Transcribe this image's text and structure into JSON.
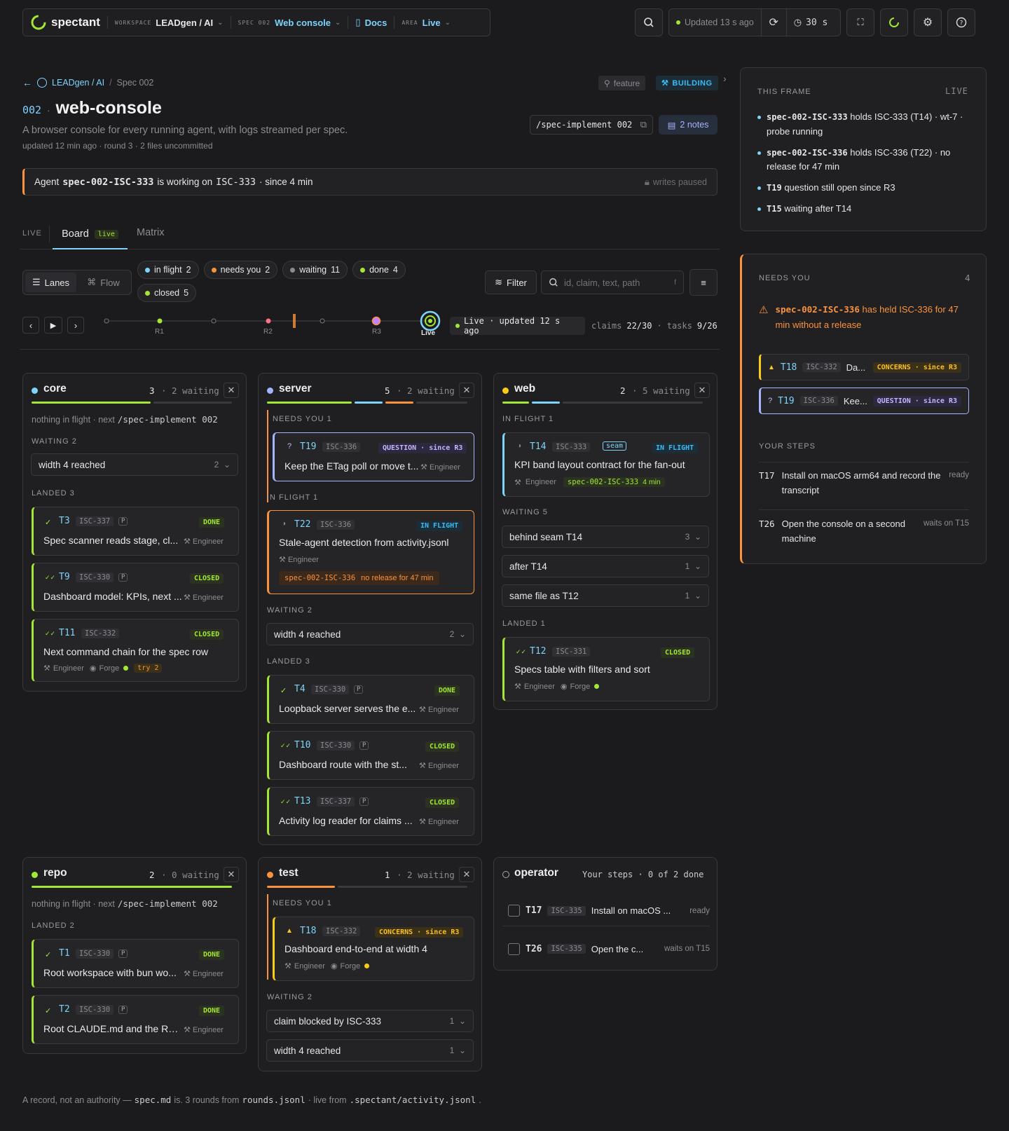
{
  "brand": {
    "name": "spectant"
  },
  "topbar": {
    "workspace_label": "WORKSPACE",
    "workspace": "LEADgen / AI",
    "spec_label": "SPEC 002",
    "spec": "Web console",
    "docs": "Docs",
    "area_label": "AREA",
    "area": "Live"
  },
  "status": {
    "updated": "Updated 13 s ago",
    "interval": "30 s"
  },
  "breadcrumb": {
    "org": "LEADgen / AI",
    "sep": "/",
    "spec": "Spec 002"
  },
  "header": {
    "num": "002",
    "dot": "·",
    "title": "web-console",
    "desc": "A browser console for every running agent, with logs streamed per spec.",
    "meta": "updated 12 min ago · round 3 · 2 files uncommitted",
    "feature": "feature",
    "building": "BUILDING",
    "command": "/spec-implement 002",
    "notes": "2 notes"
  },
  "banner": {
    "pre": "Agent",
    "agent": "spec-002-ISC-333",
    "mid": "is working on",
    "task": "ISC-333",
    "post": "· since 4 min",
    "writes": "writes paused"
  },
  "tabs": {
    "live_label": "LIVE",
    "board": "Board",
    "board_badge": "live",
    "matrix": "Matrix"
  },
  "controls": {
    "lanes": "Lanes",
    "flow": "Flow",
    "filter": "Filter",
    "search_placeholder": "id, claim, text, path",
    "search_key": "f"
  },
  "filters": [
    {
      "label": "in flight",
      "count": "2",
      "color": "#7dd3fc"
    },
    {
      "label": "needs you",
      "count": "2",
      "color": "#fb923c"
    },
    {
      "label": "waiting",
      "count": "11",
      "color": "#8c8c90"
    },
    {
      "label": "done",
      "count": "4",
      "color": "#a3e635"
    },
    {
      "label": "closed",
      "count": "5",
      "color": "#a3e635"
    }
  ],
  "timeline": {
    "r1": "R1",
    "r2": "R2",
    "r3": "R3",
    "live": "Live",
    "live_status": "Live · updated 12 s ago",
    "claims_label": "claims",
    "claims": "22/30",
    "tasks_label": "tasks",
    "tasks": "9/26",
    "sep": "·"
  },
  "cols": {
    "core": {
      "name": "core",
      "count": "3",
      "waiting": "· 2 waiting",
      "idle": "nothing in flight · next",
      "next": "/spec-implement 002",
      "waiting_sect": "WAITING 2",
      "landed_sect": "LANDED 3",
      "waiting_items": [
        {
          "label": "width 4 reached",
          "n": "2"
        }
      ],
      "tasks": [
        {
          "id": "T3",
          "isc": "ISC-337",
          "p": "P",
          "status": "DONE",
          "title": "Spec scanner reads stage, cl...",
          "role": "Engineer",
          "mark": "✓"
        },
        {
          "id": "T9",
          "isc": "ISC-330",
          "p": "P",
          "status": "CLOSED",
          "title": "Dashboard model: KPIs, next ...",
          "role": "Engineer",
          "mark": "✓✓"
        },
        {
          "id": "T11",
          "isc": "ISC-332",
          "status": "CLOSED",
          "title": "Next command chain for the spec row",
          "role": "Engineer",
          "forge": "Forge",
          "try": "try 2",
          "mark": "✓✓"
        }
      ]
    },
    "server": {
      "name": "server",
      "count": "5",
      "waiting": "· 2 waiting",
      "needs_sect": "NEEDS YOU 1",
      "inflight_sect": "IN FLIGHT 1",
      "waiting_sect": "WAITING 2",
      "landed_sect": "LANDED 3",
      "needs": {
        "id": "T19",
        "isc": "ISC-336",
        "status": "QUESTION · since R3",
        "title": "Keep the ETag poll or move t...",
        "role": "Engineer",
        "mark": "?"
      },
      "inflight": {
        "id": "T22",
        "isc": "ISC-336",
        "status": "IN FLIGHT",
        "title": "Stale-agent detection from activity.jsonl",
        "role": "Engineer",
        "agent": "spec-002-ISC-336",
        "warn": "no release for 47 min"
      },
      "waiting_items": [
        {
          "label": "width 4 reached",
          "n": "2"
        }
      ],
      "tasks": [
        {
          "id": "T4",
          "isc": "ISC-330",
          "p": "P",
          "status": "DONE",
          "title": "Loopback server serves the e...",
          "role": "Engineer",
          "mark": "✓"
        },
        {
          "id": "T10",
          "isc": "ISC-330",
          "p": "P",
          "status": "CLOSED",
          "title": "Dashboard route with the st...",
          "role": "Engineer",
          "mark": "✓✓"
        },
        {
          "id": "T13",
          "isc": "ISC-337",
          "p": "P",
          "status": "CLOSED",
          "title": "Activity log reader for claims ...",
          "role": "Engineer",
          "mark": "✓✓"
        }
      ]
    },
    "web": {
      "name": "web",
      "count": "2",
      "waiting": "· 5 waiting",
      "inflight_sect": "IN FLIGHT 1",
      "waiting_sect": "WAITING 5",
      "landed_sect": "LANDED 1",
      "inflight": {
        "id": "T14",
        "isc": "ISC-333",
        "seam": "seam",
        "status": "IN FLIGHT",
        "title": "KPI band layout contract for the fan-out",
        "role": "Engineer",
        "agent": "spec-002-ISC-333",
        "time": "4 min"
      },
      "waiting_items": [
        {
          "label": "behind seam T14",
          "n": "3"
        },
        {
          "label": "after T14",
          "n": "1"
        },
        {
          "label": "same file as T12",
          "n": "1"
        }
      ],
      "tasks": [
        {
          "id": "T12",
          "isc": "ISC-331",
          "status": "CLOSED",
          "title": "Specs table with filters and sort",
          "role": "Engineer",
          "forge": "Forge",
          "mark": "✓✓"
        }
      ]
    },
    "repo": {
      "name": "repo",
      "count": "2",
      "waiting": "· 0 waiting",
      "idle": "nothing in flight · next",
      "next": "/spec-implement 002",
      "landed_sect": "LANDED 2",
      "tasks": [
        {
          "id": "T1",
          "isc": "ISC-330",
          "p": "P",
          "status": "DONE",
          "title": "Root workspace with bun wo...",
          "role": "Engineer",
          "mark": "✓"
        },
        {
          "id": "T2",
          "isc": "ISC-330",
          "p": "P",
          "status": "DONE",
          "title": "Root CLAUDE.md and the RE...",
          "role": "Engineer",
          "mark": "✓"
        }
      ]
    },
    "test": {
      "name": "test",
      "count": "1",
      "waiting": "· 2 waiting",
      "needs_sect": "NEEDS YOU 1",
      "waiting_sect": "WAITING 2",
      "needs": {
        "id": "T18",
        "isc": "ISC-332",
        "status": "CONCERNS · since R3",
        "title": "Dashboard end-to-end at width 4",
        "role": "Engineer",
        "forge": "Forge",
        "mark": "▲"
      },
      "waiting_items": [
        {
          "label": "claim blocked by ISC-333",
          "n": "1"
        },
        {
          "label": "width 4 reached",
          "n": "1"
        }
      ]
    },
    "operator": {
      "name": "operator",
      "steps": "Your steps · 0 of 2 done",
      "items": [
        {
          "id": "T17",
          "isc": "ISC-335",
          "title": "Install on macOS ...",
          "state": "ready"
        },
        {
          "id": "T26",
          "isc": "ISC-335",
          "title": "Open the c...",
          "state": "waits on T15"
        }
      ]
    }
  },
  "frame": {
    "title": "THIS FRAME",
    "live": "LIVE",
    "items": [
      {
        "b": "spec-002-ISC-333",
        "t": "holds ISC-333 (T14) · wt-7 · probe running"
      },
      {
        "b": "spec-002-ISC-336",
        "t": "holds ISC-336 (T22) · no release for 47 min"
      },
      {
        "b": "T19",
        "t": "question still open since R3"
      },
      {
        "b": "T15",
        "t": "waiting after T14"
      }
    ]
  },
  "needs": {
    "title": "NEEDS YOU",
    "count": "4",
    "alert_b": "spec-002-ISC-336",
    "alert_t": "has held ISC-336 for 47 min without a release",
    "items": [
      {
        "mark": "▲",
        "id": "T18",
        "isc": "ISC-332",
        "title": "Da...",
        "status": "CONCERNS · since R3"
      },
      {
        "mark": "?",
        "id": "T19",
        "isc": "ISC-336",
        "title": "Kee...",
        "status": "QUESTION · since R3"
      }
    ],
    "steps_title": "YOUR STEPS",
    "steps": [
      {
        "id": "T17",
        "title": "Install on macOS arm64 and record the transcript",
        "state": "ready"
      },
      {
        "id": "T26",
        "title": "Open the console on a second machine",
        "state": "waits on T15"
      }
    ]
  },
  "footer": {
    "a": "A record, not an authority —",
    "f1": "spec.md",
    "b": "is. 3 rounds from",
    "f2": "rounds.jsonl",
    "c": "· live from",
    "f3": ".spectant/activity.jsonl",
    "d": "."
  }
}
